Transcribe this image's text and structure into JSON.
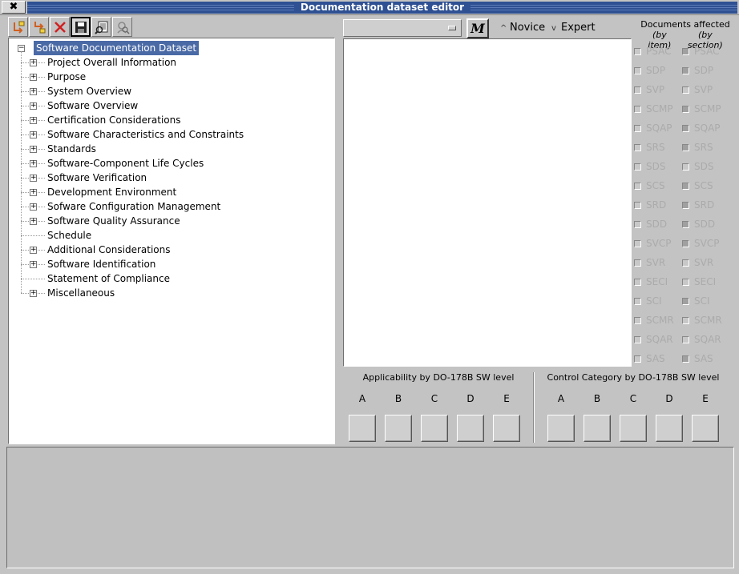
{
  "window": {
    "title": "Documentation dataset editor",
    "close_glyph": "✖"
  },
  "toolbar": {
    "buttons": [
      {
        "icon": "add-child-icon"
      },
      {
        "icon": "add-sibling-icon"
      },
      {
        "icon": "delete-icon"
      },
      {
        "icon": "save-icon"
      },
      {
        "icon": "preview-icon"
      },
      {
        "icon": "find-icon"
      }
    ]
  },
  "tree": {
    "root": "Software Documentation Dataset",
    "items": [
      {
        "label": "Project Overall Information",
        "expandable": true
      },
      {
        "label": "Purpose",
        "expandable": true
      },
      {
        "label": "System Overview",
        "expandable": true
      },
      {
        "label": "Software Overview",
        "expandable": true
      },
      {
        "label": "Certification Considerations",
        "expandable": true
      },
      {
        "label": "Software Characteristics and Constraints",
        "expandable": true
      },
      {
        "label": "Standards",
        "expandable": true
      },
      {
        "label": "Software-Component Life Cycles",
        "expandable": true
      },
      {
        "label": "Software Verification",
        "expandable": true
      },
      {
        "label": "Development Environment",
        "expandable": true
      },
      {
        "label": "Sofware Configuration Management",
        "expandable": true
      },
      {
        "label": "Software Quality Assurance",
        "expandable": true
      },
      {
        "label": "Schedule",
        "expandable": false
      },
      {
        "label": "Additional Considerations",
        "expandable": true
      },
      {
        "label": "Software Identification",
        "expandable": true
      },
      {
        "label": "Statement of Compliance",
        "expandable": false
      },
      {
        "label": "Miscellaneous",
        "expandable": true
      }
    ]
  },
  "editor": {
    "combo_value": "",
    "m_button": "M",
    "mode_novice": "Novice",
    "mode_expert": "Expert"
  },
  "docs_affected": {
    "title": "Documents affected",
    "by_item": "(by item)",
    "by_section": "(by section)",
    "docs": [
      "PSAC",
      "SDP",
      "SVP",
      "SCMP",
      "SQAP",
      "SRS",
      "SDS",
      "SCS",
      "SRD",
      "SDD",
      "SVCP",
      "SVR",
      "SECI",
      "SCI",
      "SCMR",
      "SQAR",
      "SAS"
    ],
    "section_dark": [
      true,
      true,
      false,
      true,
      true,
      true,
      false,
      true,
      true,
      true,
      true,
      false,
      false,
      true,
      false,
      false,
      true
    ]
  },
  "levels": {
    "applicability_label": "Applicability by DO-178B SW level",
    "control_label": "Control Category by DO-178B SW level",
    "letters": [
      "A",
      "B",
      "C",
      "D",
      "E"
    ]
  }
}
